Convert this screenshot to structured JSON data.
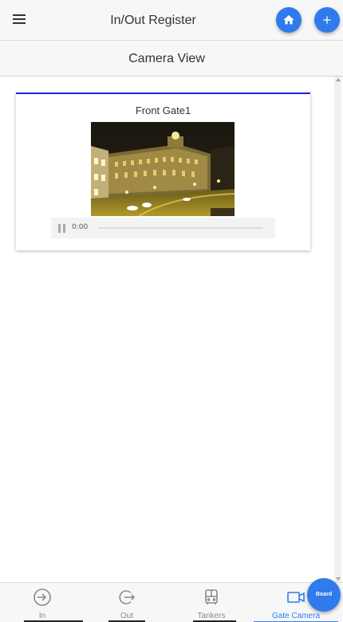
{
  "header": {
    "title": "In/Out Register",
    "menu_icon": "menu-icon",
    "home_icon": "home-icon",
    "add_icon": "plus-icon"
  },
  "subheader": {
    "title": "Camera View"
  },
  "camera": {
    "title": "Front Gate1",
    "time": "0:00",
    "pause_icon": "pause-icon"
  },
  "bottom_nav": {
    "items": [
      {
        "label": "In",
        "icon": "login-icon"
      },
      {
        "label": "Out",
        "icon": "logout-icon"
      },
      {
        "label": "Tankers",
        "icon": "bus-icon"
      },
      {
        "label": "Gate Camera",
        "icon": "video-camera-icon"
      }
    ],
    "active": "Gate Camera"
  },
  "board_button": {
    "label": "Board"
  },
  "colors": {
    "accent": "#2f7bec",
    "card_top_border": "#1d2ad8",
    "bar_background": "#f7f7f7"
  }
}
